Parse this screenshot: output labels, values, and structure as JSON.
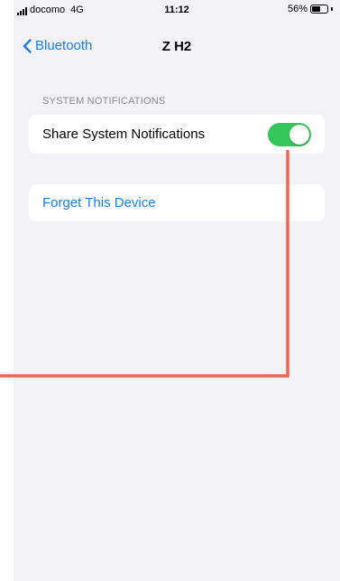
{
  "status": {
    "carrier": "docomo",
    "network": "4G",
    "time": "11:12",
    "battery_pct": "56%",
    "battery_level": 0.56
  },
  "nav": {
    "back_label": "Bluetooth",
    "title": "Z H2"
  },
  "notifications": {
    "section_header": "SYSTEM NOTIFICATIONS",
    "share_label": "Share System Notifications",
    "share_enabled": true
  },
  "device": {
    "forget_label": "Forget This Device"
  },
  "colors": {
    "accent": "#1a7cf5",
    "toggle_on": "#34c759",
    "annotation": "#f26552",
    "background": "#f2f2f7"
  },
  "icons": {
    "back": "chevron-left-icon",
    "signal": "signal-bars-icon",
    "battery": "battery-icon"
  }
}
